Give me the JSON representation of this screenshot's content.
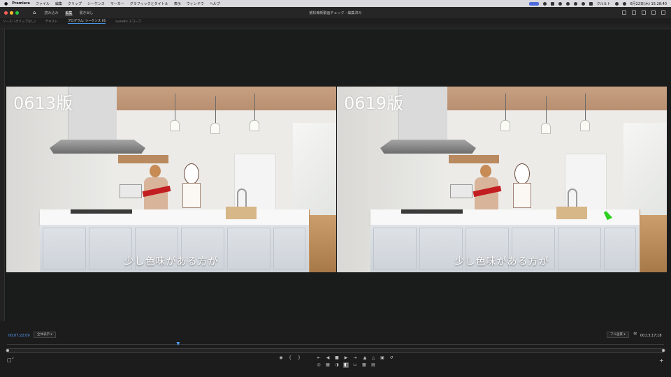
{
  "menubar": {
    "app": "Premiere",
    "items": [
      "ファイル",
      "編集",
      "クリップ",
      "シーケンス",
      "マーカー",
      "グラフィックとタイトル",
      "表示",
      "ウィンドウ",
      "ヘルプ"
    ],
    "clock": "6月22日(木) 15:28:40",
    "user_label": "クルルト"
  },
  "titlebar": {
    "workspaces": [
      "読み込み",
      "編集",
      "書き出し"
    ],
    "active_workspace": "編集",
    "document_title": "観松庵新動画チェック - 編集済み"
  },
  "panel_tabs": [
    "ソース: (クリップなし)",
    "テキスト",
    "プログラム: シーケンス 01",
    "Lumetri スコープ"
  ],
  "panel_tabs_active": "プログラム: シーケンス 01",
  "viewer": {
    "left_label": "0613版",
    "right_label": "0619版",
    "subtitle": "少し色味がある方が"
  },
  "controls": {
    "timecode_current": "00;07;22;09",
    "fit": "全体表示",
    "quality": "フル画質",
    "timecode_duration": "00;13;17;18"
  },
  "playback": {
    "playhead_fraction": 0.26
  },
  "transport_icons": [
    "marker-icon",
    "in-point-icon",
    "out-point-icon",
    "go-to-in-icon",
    "step-back-icon",
    "stop-icon",
    "step-forward-icon",
    "go-to-out-icon",
    "lift-icon",
    "extract-icon",
    "export-frame-icon",
    "undo-icon"
  ],
  "colors": {
    "accent": "#4a9bef",
    "timecode": "#5aa0ff",
    "cursor": "#2ed11f"
  }
}
